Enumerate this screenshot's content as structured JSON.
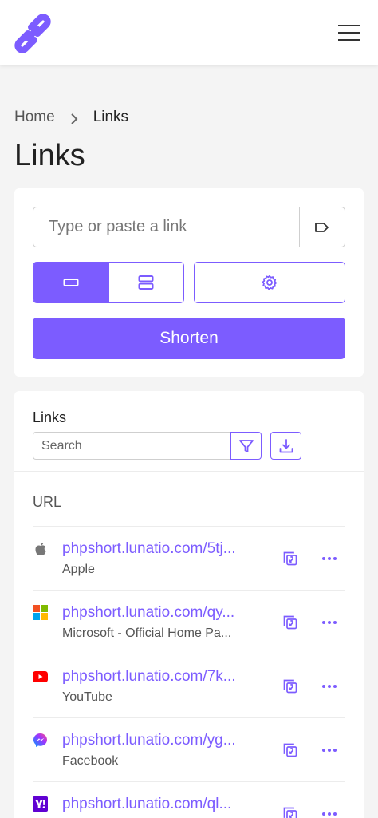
{
  "colors": {
    "accent": "#7c5cff",
    "background": "#f4f4f4"
  },
  "header": {
    "logo_icon": "chain-link-logo-icon",
    "menu_icon": "hamburger-icon"
  },
  "breadcrumb": {
    "home": "Home",
    "separator_icon": "chevron-right-icon",
    "current": "Links"
  },
  "page_title": "Links",
  "shortener": {
    "input_placeholder": "Type or paste a link",
    "tag_icon": "tag-icon",
    "modes": [
      {
        "icon": "single-link-mode-icon",
        "active": true
      },
      {
        "icon": "multiple-links-mode-icon",
        "active": false
      }
    ],
    "settings_icon": "gear-icon",
    "shorten_label": "Shorten"
  },
  "links_panel": {
    "title": "Links",
    "search_placeholder": "Search",
    "filter_icon": "filter-icon",
    "export_icon": "download-icon",
    "column_header": "URL",
    "rows": [
      {
        "favicon": "apple-icon",
        "url": "phpshort.lunatio.com/5tj...",
        "title": "Apple"
      },
      {
        "favicon": "microsoft-icon",
        "url": "phpshort.lunatio.com/qy...",
        "title": "Microsoft - Official Home Pa..."
      },
      {
        "favicon": "youtube-icon",
        "url": "phpshort.lunatio.com/7k...",
        "title": "YouTube"
      },
      {
        "favicon": "messenger-icon",
        "url": "phpshort.lunatio.com/yg...",
        "title": "Facebook"
      },
      {
        "favicon": "yahoo-icon",
        "url": "phpshort.lunatio.com/ql...",
        "title": ""
      }
    ]
  }
}
